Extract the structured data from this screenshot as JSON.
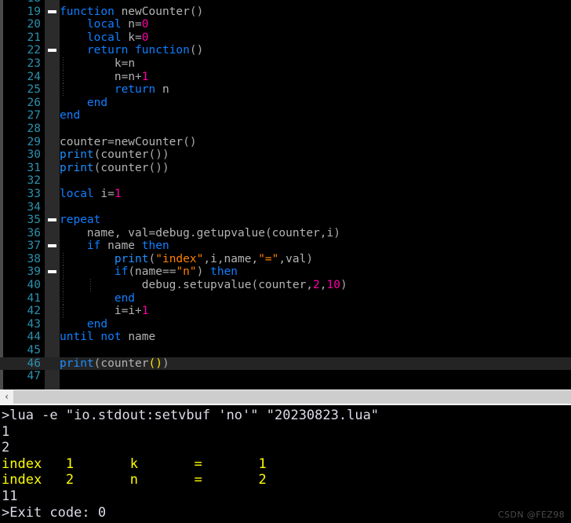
{
  "editor": {
    "first_partial_line_number": "18",
    "gutter_color": "#2b91af",
    "background": "#000000",
    "current_line_background": "#242424",
    "lines": [
      {
        "n": "19",
        "fold": true,
        "indent_guides": 0,
        "current": false,
        "tokens": [
          {
            "t": "function",
            "c": "kw"
          },
          {
            "t": " ",
            "c": "id"
          },
          {
            "t": "newCounter",
            "c": "id"
          },
          {
            "t": "(",
            "c": "pun"
          },
          {
            "t": ")",
            "c": "pun"
          }
        ]
      },
      {
        "n": "20",
        "fold": false,
        "indent_guides": 0,
        "current": false,
        "tokens": [
          {
            "t": "    ",
            "c": "id"
          },
          {
            "t": "local",
            "c": "kw"
          },
          {
            "t": " n",
            "c": "id"
          },
          {
            "t": "=",
            "c": "pun"
          },
          {
            "t": "0",
            "c": "num"
          }
        ]
      },
      {
        "n": "21",
        "fold": false,
        "indent_guides": 0,
        "current": false,
        "tokens": [
          {
            "t": "    ",
            "c": "id"
          },
          {
            "t": "local",
            "c": "kw"
          },
          {
            "t": " k",
            "c": "id"
          },
          {
            "t": "=",
            "c": "pun"
          },
          {
            "t": "0",
            "c": "num"
          }
        ]
      },
      {
        "n": "22",
        "fold": true,
        "indent_guides": 0,
        "current": false,
        "tokens": [
          {
            "t": "    ",
            "c": "id"
          },
          {
            "t": "return",
            "c": "kw"
          },
          {
            "t": " ",
            "c": "id"
          },
          {
            "t": "function",
            "c": "kw"
          },
          {
            "t": "(",
            "c": "pun"
          },
          {
            "t": ")",
            "c": "pun"
          }
        ]
      },
      {
        "n": "23",
        "fold": false,
        "indent_guides": 1,
        "current": false,
        "tokens": [
          {
            "t": "        k",
            "c": "id"
          },
          {
            "t": "=",
            "c": "pun"
          },
          {
            "t": "n",
            "c": "id"
          }
        ]
      },
      {
        "n": "24",
        "fold": false,
        "indent_guides": 1,
        "current": false,
        "tokens": [
          {
            "t": "        n",
            "c": "id"
          },
          {
            "t": "=",
            "c": "pun"
          },
          {
            "t": "n",
            "c": "id"
          },
          {
            "t": "+",
            "c": "pun"
          },
          {
            "t": "1",
            "c": "num"
          }
        ]
      },
      {
        "n": "25",
        "fold": false,
        "indent_guides": 1,
        "current": false,
        "tokens": [
          {
            "t": "        ",
            "c": "id"
          },
          {
            "t": "return",
            "c": "kw"
          },
          {
            "t": " n",
            "c": "id"
          }
        ]
      },
      {
        "n": "26",
        "fold": false,
        "indent_guides": 0,
        "current": false,
        "tokens": [
          {
            "t": "    ",
            "c": "id"
          },
          {
            "t": "end",
            "c": "kw"
          }
        ]
      },
      {
        "n": "27",
        "fold": false,
        "indent_guides": 0,
        "current": false,
        "tokens": [
          {
            "t": "end",
            "c": "kw"
          }
        ]
      },
      {
        "n": "28",
        "fold": false,
        "indent_guides": 0,
        "current": false,
        "tokens": []
      },
      {
        "n": "29",
        "fold": false,
        "indent_guides": 0,
        "current": false,
        "tokens": [
          {
            "t": "counter",
            "c": "id"
          },
          {
            "t": "=",
            "c": "pun"
          },
          {
            "t": "newCounter",
            "c": "id"
          },
          {
            "t": "(",
            "c": "pun"
          },
          {
            "t": ")",
            "c": "pun"
          }
        ]
      },
      {
        "n": "30",
        "fold": false,
        "indent_guides": 0,
        "current": false,
        "tokens": [
          {
            "t": "print",
            "c": "fn"
          },
          {
            "t": "(",
            "c": "pun"
          },
          {
            "t": "counter",
            "c": "id"
          },
          {
            "t": "()",
            "c": "pun"
          },
          {
            "t": ")",
            "c": "pun"
          }
        ]
      },
      {
        "n": "31",
        "fold": false,
        "indent_guides": 0,
        "current": false,
        "tokens": [
          {
            "t": "print",
            "c": "fn"
          },
          {
            "t": "(",
            "c": "pun"
          },
          {
            "t": "counter",
            "c": "id"
          },
          {
            "t": "()",
            "c": "pun"
          },
          {
            "t": ")",
            "c": "pun"
          }
        ]
      },
      {
        "n": "32",
        "fold": false,
        "indent_guides": 0,
        "current": false,
        "tokens": []
      },
      {
        "n": "33",
        "fold": false,
        "indent_guides": 0,
        "current": false,
        "tokens": [
          {
            "t": "local",
            "c": "kw"
          },
          {
            "t": " i",
            "c": "id"
          },
          {
            "t": "=",
            "c": "pun"
          },
          {
            "t": "1",
            "c": "num"
          }
        ]
      },
      {
        "n": "34",
        "fold": false,
        "indent_guides": 0,
        "current": false,
        "tokens": []
      },
      {
        "n": "35",
        "fold": true,
        "indent_guides": 0,
        "current": false,
        "tokens": [
          {
            "t": "repeat",
            "c": "kw"
          }
        ]
      },
      {
        "n": "36",
        "fold": false,
        "indent_guides": 0,
        "current": false,
        "tokens": [
          {
            "t": "    name, val",
            "c": "id"
          },
          {
            "t": "=",
            "c": "pun"
          },
          {
            "t": "debug",
            "c": "id"
          },
          {
            "t": ".",
            "c": "pun"
          },
          {
            "t": "getupvalue",
            "c": "id"
          },
          {
            "t": "(",
            "c": "pun"
          },
          {
            "t": "counter",
            "c": "id"
          },
          {
            "t": ",",
            "c": "pun"
          },
          {
            "t": "i",
            "c": "id"
          },
          {
            "t": ")",
            "c": "pun"
          }
        ]
      },
      {
        "n": "37",
        "fold": true,
        "indent_guides": 0,
        "current": false,
        "tokens": [
          {
            "t": "    ",
            "c": "id"
          },
          {
            "t": "if",
            "c": "kw"
          },
          {
            "t": " name ",
            "c": "id"
          },
          {
            "t": "then",
            "c": "kw"
          }
        ]
      },
      {
        "n": "38",
        "fold": false,
        "indent_guides": 1,
        "current": false,
        "tokens": [
          {
            "t": "        ",
            "c": "id"
          },
          {
            "t": "print",
            "c": "fn"
          },
          {
            "t": "(",
            "c": "pun"
          },
          {
            "t": "\"index\"",
            "c": "str"
          },
          {
            "t": ",",
            "c": "pun"
          },
          {
            "t": "i",
            "c": "id"
          },
          {
            "t": ",",
            "c": "pun"
          },
          {
            "t": "name",
            "c": "id"
          },
          {
            "t": ",",
            "c": "pun"
          },
          {
            "t": "\"=\"",
            "c": "str"
          },
          {
            "t": ",",
            "c": "pun"
          },
          {
            "t": "val",
            "c": "id"
          },
          {
            "t": ")",
            "c": "pun"
          }
        ]
      },
      {
        "n": "39",
        "fold": true,
        "indent_guides": 1,
        "current": false,
        "tokens": [
          {
            "t": "        ",
            "c": "id"
          },
          {
            "t": "if",
            "c": "kw"
          },
          {
            "t": "(",
            "c": "pun"
          },
          {
            "t": "name",
            "c": "id"
          },
          {
            "t": "==",
            "c": "pun"
          },
          {
            "t": "\"n\"",
            "c": "str"
          },
          {
            "t": ")",
            "c": "pun"
          },
          {
            "t": " ",
            "c": "id"
          },
          {
            "t": "then",
            "c": "kw"
          }
        ]
      },
      {
        "n": "40",
        "fold": false,
        "indent_guides": 2,
        "current": false,
        "tokens": [
          {
            "t": "            debug",
            "c": "id"
          },
          {
            "t": ".",
            "c": "pun"
          },
          {
            "t": "setupvalue",
            "c": "id"
          },
          {
            "t": "(",
            "c": "pun"
          },
          {
            "t": "counter",
            "c": "id"
          },
          {
            "t": ",",
            "c": "pun"
          },
          {
            "t": "2",
            "c": "num"
          },
          {
            "t": ",",
            "c": "pun"
          },
          {
            "t": "10",
            "c": "num"
          },
          {
            "t": ")",
            "c": "pun"
          }
        ]
      },
      {
        "n": "41",
        "fold": false,
        "indent_guides": 1,
        "current": false,
        "tokens": [
          {
            "t": "        ",
            "c": "id"
          },
          {
            "t": "end",
            "c": "kw"
          }
        ]
      },
      {
        "n": "42",
        "fold": false,
        "indent_guides": 1,
        "current": false,
        "tokens": [
          {
            "t": "        i",
            "c": "id"
          },
          {
            "t": "=",
            "c": "pun"
          },
          {
            "t": "i",
            "c": "id"
          },
          {
            "t": "+",
            "c": "pun"
          },
          {
            "t": "1",
            "c": "num"
          }
        ]
      },
      {
        "n": "43",
        "fold": false,
        "indent_guides": 0,
        "current": false,
        "tokens": [
          {
            "t": "    ",
            "c": "id"
          },
          {
            "t": "end",
            "c": "kw"
          }
        ]
      },
      {
        "n": "44",
        "fold": false,
        "indent_guides": 0,
        "current": false,
        "tokens": [
          {
            "t": "until",
            "c": "kw"
          },
          {
            "t": " ",
            "c": "id"
          },
          {
            "t": "not",
            "c": "kw"
          },
          {
            "t": " name",
            "c": "id"
          }
        ]
      },
      {
        "n": "45",
        "fold": false,
        "indent_guides": 0,
        "current": false,
        "tokens": []
      },
      {
        "n": "46",
        "fold": false,
        "indent_guides": 0,
        "current": true,
        "tokens": [
          {
            "t": "print",
            "c": "fn"
          },
          {
            "t": "(",
            "c": "pun"
          },
          {
            "t": "counter",
            "c": "id"
          },
          {
            "t": "()",
            "c": "brk"
          },
          {
            "t": ")",
            "c": "pun"
          }
        ]
      },
      {
        "n": "47",
        "fold": false,
        "indent_guides": 0,
        "current": false,
        "tokens": []
      }
    ]
  },
  "scrollbar": {
    "left_arrow_glyph": "‹"
  },
  "terminal": {
    "lines": [
      {
        "text": ">lua -e \"io.stdout:setvbuf 'no'\" \"20230823.lua\"",
        "color": "white"
      },
      {
        "text": "1",
        "color": "white"
      },
      {
        "text": "2",
        "color": "white"
      },
      {
        "text": "index   1       k       =       1",
        "color": "yellow"
      },
      {
        "text": "index   2       n       =       2",
        "color": "yellow"
      },
      {
        "text": "11",
        "color": "white"
      },
      {
        "text": ">Exit code: 0",
        "color": "white"
      }
    ]
  },
  "watermark": {
    "text": "CSDN @FEZ98"
  }
}
